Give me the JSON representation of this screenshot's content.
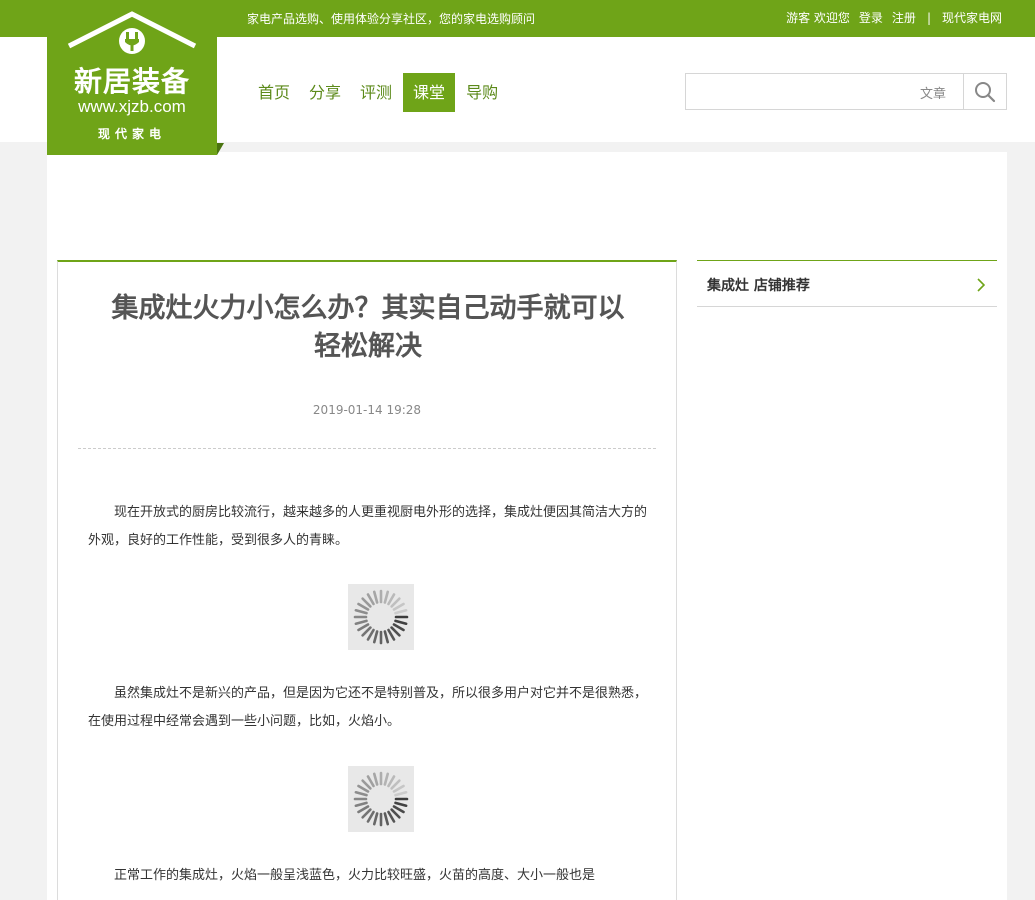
{
  "topbar": {
    "tagline": "家电产品选购、使用体验分享社区，您的家电选购顾问",
    "guest_text": "游客 欢迎您",
    "login": "登录",
    "register": "注册",
    "separator": "|",
    "site_link": "现代家电网"
  },
  "logo": {
    "name": "新居装备",
    "url": "www.xjzb.com",
    "sub": "现代家电",
    "icon": "house-plug-icon"
  },
  "nav": {
    "items": [
      "首页",
      "分享",
      "评测",
      "课堂",
      "导购"
    ],
    "active": "课堂"
  },
  "search": {
    "placeholder": "",
    "type_label": "文章",
    "icon": "search-icon"
  },
  "article": {
    "title_line1": "集成灶火力小怎么办？其实自己动手就可以",
    "title_line2": "轻松解决",
    "date": "2019-01-14 19:28",
    "paragraphs": [
      "现在开放式的厨房比较流行，越来越多的人更重视厨电外形的选择，集成灶便因其简洁大方的外观，良好的工作性能，受到很多人的青睐。",
      "虽然集成灶不是新兴的产品，但是因为它还不是特别普及，所以很多用户对它并不是很熟悉，在使用过程中经常会遇到一些小问题，比如，火焰小。",
      "正常工作的集成灶，火焰一般呈浅蓝色，火力比较旺盛，火苗的高度、大小一般也是"
    ],
    "image_placeholder_icon": "loading-spinner-icon"
  },
  "sidebar": {
    "title": "集成灶 店铺推荐",
    "icon": "chevron-right-icon"
  },
  "colors": {
    "brand_green": "#6fa418",
    "nav_text": "#5c8a1a"
  }
}
